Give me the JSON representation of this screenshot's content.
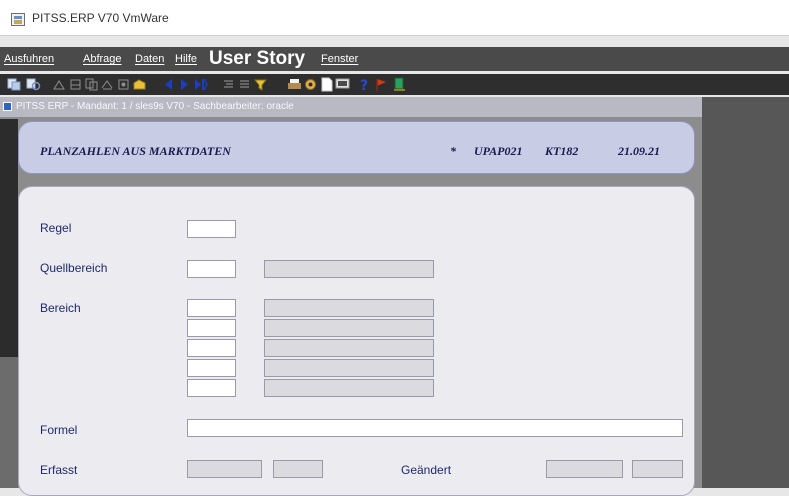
{
  "window": {
    "title": "PITSS.ERP V70 VmWare",
    "icon": "app-window-icon"
  },
  "menu": {
    "items": [
      "Ausfuhren",
      "Abfrage",
      "Daten",
      "Hilfe"
    ],
    "user_story": "User Story",
    "fenster": "Fenster"
  },
  "toolbar": {
    "icons": [
      "execute-query-icon",
      "enter-query-icon",
      "save-icon",
      "print-icon",
      "copy-record-icon",
      "insert-record-icon",
      "delete-record-icon",
      "clear-icon",
      "previous-icon",
      "next-icon",
      "last-record-icon",
      "list-icon",
      "edit-icon",
      "filter-icon",
      "printer-icon",
      "settings-icon",
      "new-document-icon",
      "display-icon",
      "help-icon",
      "flag-icon",
      "exit-icon"
    ],
    "colors": {
      "arrows": "#1b3dbf",
      "help": "#1f3ec7",
      "folder": "#e8c33a",
      "flag": "#d23a16"
    }
  },
  "inner_window": {
    "title": "PITSS ERP  -  Mandant: 1 / sles9s V70  -  Sachbearbeiter: oracle"
  },
  "header": {
    "title": "PLANZAHLEN AUS MARKTDATEN",
    "asterisk": "*",
    "program": "UPAP021",
    "code": "KT182",
    "date": "21.09.21"
  },
  "form": {
    "regel_label": "Regel",
    "regel_value": "",
    "quellbereich_label": "Quellbereich",
    "quellbereich_value": "",
    "quellbereich_desc": "",
    "bereich_label": "Bereich",
    "bereich_rows": [
      {
        "code": "",
        "desc": ""
      },
      {
        "code": "",
        "desc": ""
      },
      {
        "code": "",
        "desc": ""
      },
      {
        "code": "",
        "desc": ""
      },
      {
        "code": "",
        "desc": ""
      }
    ],
    "formel_label": "Formel",
    "formel_value": "",
    "erfasst_label": "Erfasst",
    "erfasst_date": "",
    "erfasst_user": "",
    "geaendert_label": "Geändert",
    "geaendert_date": "",
    "geaendert_user": ""
  },
  "colors": {
    "menubar": "#4a4a4a",
    "header_panel": "#c8cce5",
    "label_text": "#1f2a6b",
    "form_bg": "#ebebf0"
  }
}
